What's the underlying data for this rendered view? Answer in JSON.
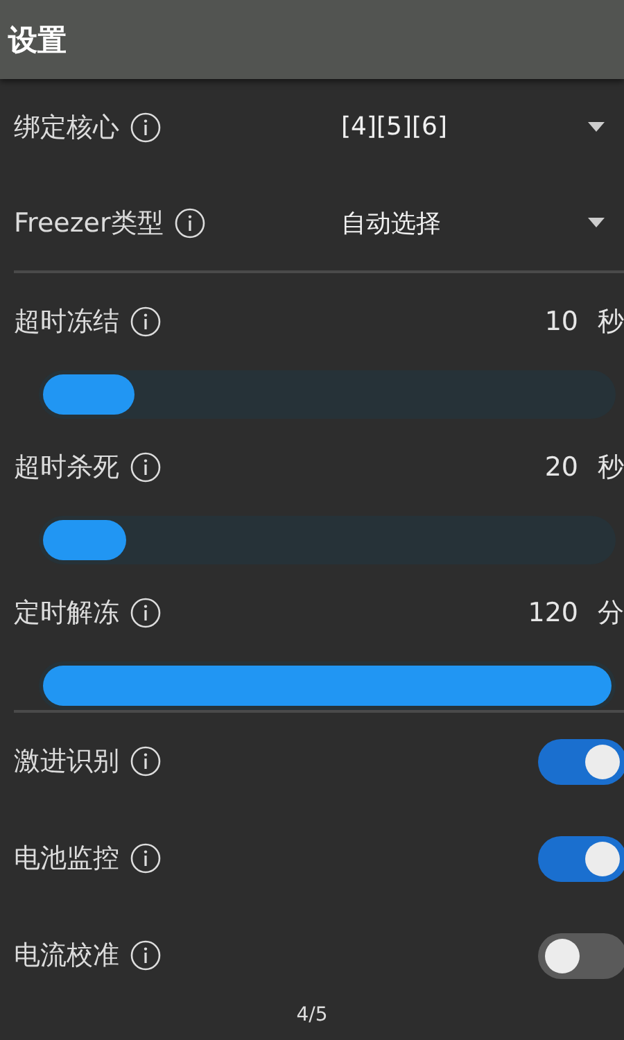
{
  "title": "设置",
  "dropdowns": [
    {
      "label": "绑定核心",
      "value": "[4][5][6]"
    },
    {
      "label": "Freezer类型",
      "value": "自动选择"
    }
  ],
  "sliders": [
    {
      "label": "超时冻结",
      "reading": "10",
      "unit": "秒",
      "level": 0.16
    },
    {
      "label": "超时杀死",
      "reading": "20",
      "unit": "秒",
      "level": 0.147
    },
    {
      "label": "定时解冻",
      "reading": "120",
      "unit": "分",
      "level": 1
    }
  ],
  "switches": [
    {
      "label": "激进识别",
      "on": true
    },
    {
      "label": "电池监控",
      "on": true
    },
    {
      "label": "电流校准",
      "on": false
    }
  ],
  "page_indicator": "4/5"
}
